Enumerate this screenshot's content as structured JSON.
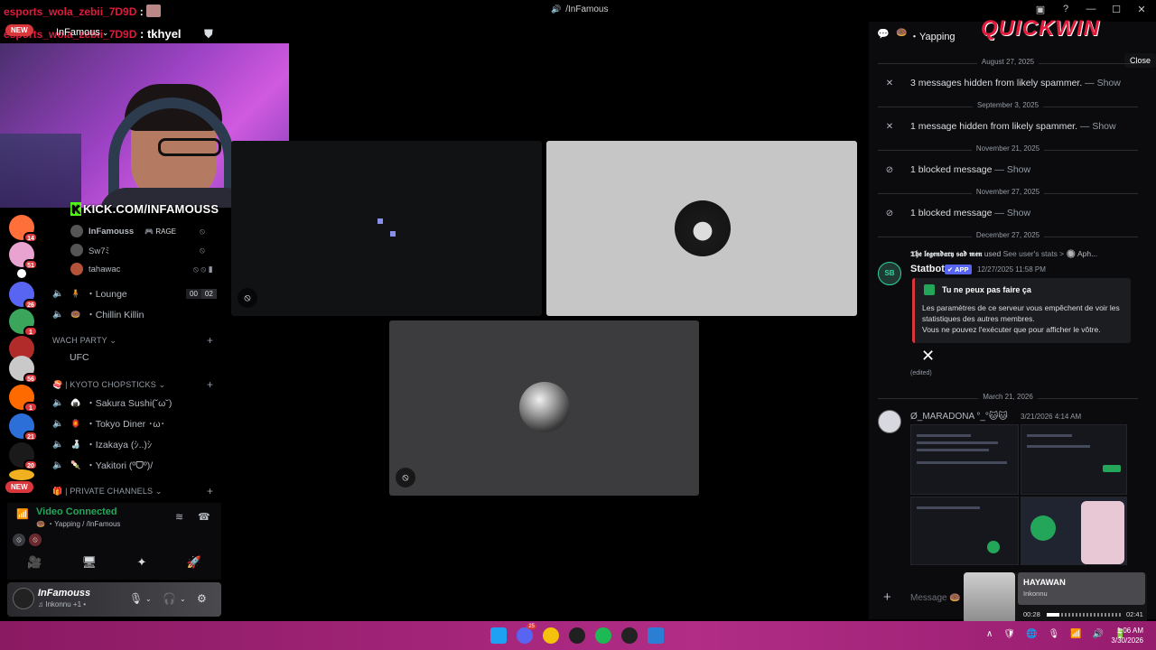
{
  "window": {
    "title": "/InFamous",
    "speaker_glyph": "🔊",
    "controls": [
      "▣",
      "?",
      "—",
      "☐",
      "✕"
    ]
  },
  "overlay": {
    "chat_user1": "esports_wola_zebii_7D9D",
    "chat_sep": " :",
    "chat_user2": "esports_wola_zebii_7D9D",
    "chat_msg2": "tkhyel",
    "new_badge": "NEW",
    "kick_letter": "K",
    "kick_url": "KICK.COM/INFAMOUSS"
  },
  "server": {
    "name": "InFamous",
    "caret": "⌄",
    "add_user_glyph": "⛊"
  },
  "rail": {
    "badges": [
      "14",
      "51",
      "",
      "26",
      "1",
      "",
      "56",
      "1",
      "21",
      "20",
      ""
    ],
    "colors": [
      "#ff6f3a",
      "#e8a3d0",
      "#ffffff",
      "#5865f2",
      "#3ba55c",
      "#b22b2b",
      "#c9c9c9",
      "#ff6a00",
      "#2c6fd8",
      "#1a1a1a",
      "#f0b020"
    ],
    "new_label": "NEW"
  },
  "channels": {
    "vc_users": [
      {
        "name": "InFamouss",
        "tag": "🎮 RAGE",
        "status": "⦸"
      },
      {
        "name": "Sw7ﾐ",
        "tag": "",
        "status": "⦸"
      },
      {
        "name": "tahawac",
        "tag": "",
        "status": "⦸ ⦸ ▮"
      }
    ],
    "voice": [
      {
        "emoji": "🧍",
        "name": "・Lounge",
        "count_a": "00",
        "count_b": "02"
      },
      {
        "emoji": "🍩",
        "name": "・Chillin Killin"
      }
    ],
    "cat_watch": "WACH PARTY ⌄",
    "plus": "+",
    "ufc": "UFC",
    "cat_kyoto": "🍣 | Kyoto chopsticks ⌄",
    "kyoto": [
      {
        "emoji": "🍙",
        "name": "・Sakura Sushi(˘ω˘)"
      },
      {
        "emoji": "🏮",
        "name": "・Tokyo Diner ･ω･"
      },
      {
        "emoji": "🍶",
        "name": "・Izakaya (ｼ..)ｼ"
      },
      {
        "emoji": "🍡",
        "name": "・Yakitori (ºᗜº)/"
      }
    ],
    "cat_private": "🎁 | PRIVATE CHANNELS ⌄",
    "speaker_glyph": "🔈"
  },
  "voice_panel": {
    "status": "Video Connected",
    "sub": "🍩 ・Yapping / /InFamous",
    "signal_glyph": "📶",
    "noise_glyph": "≋",
    "hangup_glyph": "☎",
    "row2": [
      "⦸",
      "⦸"
    ],
    "buttons": [
      "🎥",
      "🖥",
      "✦",
      "🚀"
    ]
  },
  "user_panel": {
    "name": "InFamouss",
    "sub": "♫ Inkonnu +1 •",
    "mic_glyph": "🎙",
    "headset_glyph": "🎧",
    "caret": "⌄",
    "gear_glyph": "⚙"
  },
  "tiles": {
    "mute_glyph": "⦸"
  },
  "chat": {
    "header_icon": "💬",
    "header_emoji": "🍩",
    "channel": "・Yapping",
    "logo": "QUICKWIN",
    "close_tooltip": "Close",
    "dates": [
      "August 27, 2025",
      "September 3, 2025",
      "November 21, 2025",
      "November 27, 2025",
      "December 27, 2025",
      "March 21, 2026"
    ],
    "hidden1": "3 messages hidden from likely spammer.",
    "hidden2": "1 message hidden from likely spammer.",
    "blocked1": "1 blocked message",
    "blocked2": "1 blocked message",
    "show_label": " — Show",
    "x_glyph": "✕",
    "block_glyph": "⊘",
    "reply_user": "𝕿𝖍𝖊 𝖑𝖊𝖌𝖊𝖓𝖉𝖆𝖗𝖞 𝖘𝖆𝖉 𝖒𝖊𝖓",
    "reply_used": " used ",
    "reply_link": "See user's stats > ",
    "reply_tail": "🔘 Aph...",
    "bot_avatar": "SB",
    "bot_name": "Statbot",
    "bot_tag": "✔ APP",
    "bot_time": "12/27/2025 11:58 PM",
    "embed_title": "Tu ne peux pas faire ça",
    "embed_desc1": "Les paramètres de ce serveur vous empêchent de voir les statistiques des autres membres.",
    "embed_desc2": "Vous ne pouvez l'exécuter que pour afficher le vôtre.",
    "big_x": "✕",
    "edited": "(edited)",
    "user2_name": "Ø_MARADONA °_°🐱🐱",
    "user2_time": "3/21/2026 4:14 AM",
    "input_plus": "+",
    "input_placeholder": "Message 🍩"
  },
  "music": {
    "title": "HAYAWAN",
    "artist": "Inkonnu",
    "current": "00:28",
    "duration": "02:41",
    "progress": 0.17
  },
  "taskbar": {
    "icon_colors": [
      "#1ea1f2",
      "#5865f2",
      "#f4c20d",
      "#202020",
      "#1db954",
      "#222222",
      "#2a7fd4"
    ],
    "discord_badge": "25",
    "tray": [
      "∧",
      "🛡",
      "🌐",
      "🎙",
      "📶",
      "🔊",
      "🔋"
    ],
    "time": "1:06 AM",
    "date": "3/30/2026"
  }
}
